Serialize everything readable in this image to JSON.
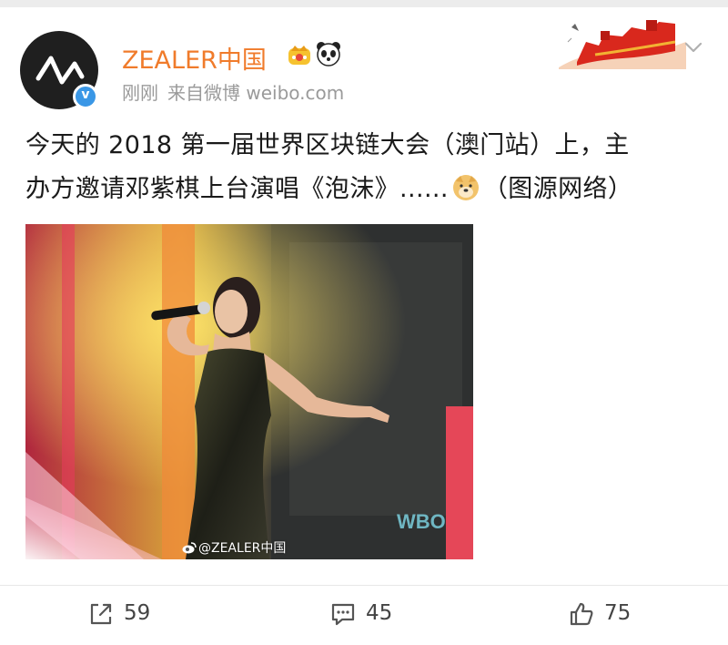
{
  "post": {
    "user": {
      "name": "ZEALER中国",
      "avatar_icon": "zealer-logo-icon",
      "verified_icon": "verified-badge-icon",
      "badges": [
        "crown-badge-icon",
        "panda-badge-icon"
      ],
      "verified_mark": "v"
    },
    "meta": {
      "time": "刚刚",
      "source": "来自微博 weibo.com"
    },
    "text": {
      "line1": "今天的 2018 第一届世界区块链大会（澳门站）上，主",
      "line2_a": "办方邀请邓紫棋上台演唱《泡沫》......",
      "line2_emoji": "doge-emoji-icon",
      "line2_b": "（图源网络）"
    },
    "image": {
      "watermark": "@ZEALER中国",
      "watermark_icon": "weibo-logo-icon",
      "stage_sign": "WBO"
    },
    "actions": {
      "share": {
        "icon": "share-icon",
        "count": "59"
      },
      "comment": {
        "icon": "comment-icon",
        "count": "45"
      },
      "like": {
        "icon": "thumbs-up-icon",
        "count": "75"
      }
    }
  },
  "colors": {
    "username": "#f07b2b",
    "meta": "#9a9a9a",
    "verified": "#3a97e6",
    "text": "#1a1a1a"
  }
}
